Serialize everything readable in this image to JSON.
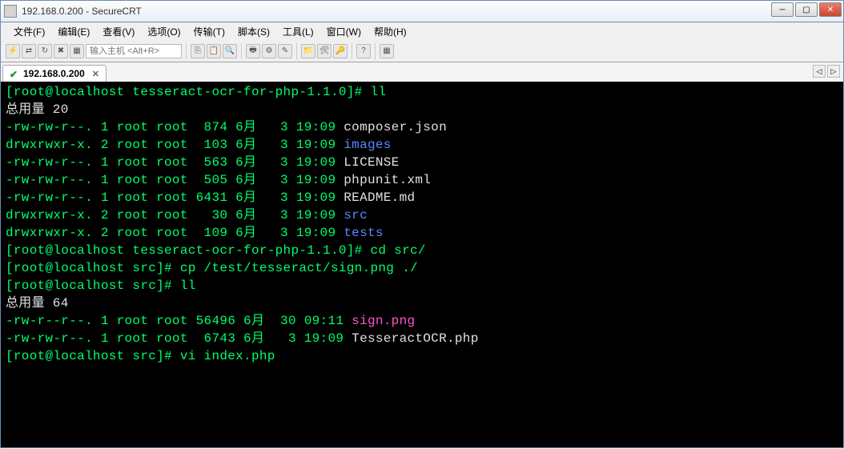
{
  "window": {
    "title": "192.168.0.200 - SecureCRT"
  },
  "menubar": [
    "文件(F)",
    "编辑(E)",
    "查看(V)",
    "选项(O)",
    "传输(T)",
    "脚本(S)",
    "工具(L)",
    "窗口(W)",
    "帮助(H)"
  ],
  "toolbar": {
    "host_placeholder": "输入主机 <Alt+R>"
  },
  "tab": {
    "label": "192.168.0.200"
  },
  "terminal": {
    "lines": [
      {
        "segments": [
          {
            "cls": "c-green",
            "text": "[root@localhost tesseract-ocr-for-php-1.1.0]# ll"
          }
        ]
      },
      {
        "segments": [
          {
            "cls": "c-white",
            "text": "总用量 20"
          }
        ]
      },
      {
        "segments": [
          {
            "cls": "c-green",
            "text": "-rw-rw-r--. 1 root root  874 6月   3 19:09 "
          },
          {
            "cls": "c-white",
            "text": "composer.json"
          }
        ]
      },
      {
        "segments": [
          {
            "cls": "c-green",
            "text": "drwxrwxr-x. 2 root root  103 6月   3 19:09 "
          },
          {
            "cls": "c-blue",
            "text": "images"
          }
        ]
      },
      {
        "segments": [
          {
            "cls": "c-green",
            "text": "-rw-rw-r--. 1 root root  563 6月   3 19:09 "
          },
          {
            "cls": "c-white",
            "text": "LICENSE"
          }
        ]
      },
      {
        "segments": [
          {
            "cls": "c-green",
            "text": "-rw-rw-r--. 1 root root  505 6月   3 19:09 "
          },
          {
            "cls": "c-white",
            "text": "phpunit.xml"
          }
        ]
      },
      {
        "segments": [
          {
            "cls": "c-green",
            "text": "-rw-rw-r--. 1 root root 6431 6月   3 19:09 "
          },
          {
            "cls": "c-white",
            "text": "README.md"
          }
        ]
      },
      {
        "segments": [
          {
            "cls": "c-green",
            "text": "drwxrwxr-x. 2 root root   30 6月   3 19:09 "
          },
          {
            "cls": "c-blue",
            "text": "src"
          }
        ]
      },
      {
        "segments": [
          {
            "cls": "c-green",
            "text": "drwxrwxr-x. 2 root root  109 6月   3 19:09 "
          },
          {
            "cls": "c-blue",
            "text": "tests"
          }
        ]
      },
      {
        "segments": [
          {
            "cls": "c-green",
            "text": "[root@localhost tesseract-ocr-for-php-1.1.0]# cd src/"
          }
        ]
      },
      {
        "segments": [
          {
            "cls": "c-green",
            "text": "[root@localhost src]# cp /test/tesseract/sign.png ./"
          }
        ]
      },
      {
        "segments": [
          {
            "cls": "c-green",
            "text": "[root@localhost src]# ll"
          }
        ]
      },
      {
        "segments": [
          {
            "cls": "c-white",
            "text": "总用量 64"
          }
        ]
      },
      {
        "segments": [
          {
            "cls": "c-green",
            "text": "-rw-r--r--. 1 root root 56496 6月  30 09:11 "
          },
          {
            "cls": "c-magenta",
            "text": "sign.png"
          }
        ]
      },
      {
        "segments": [
          {
            "cls": "c-green",
            "text": "-rw-rw-r--. 1 root root  6743 6月   3 19:09 "
          },
          {
            "cls": "c-white",
            "text": "TesseractOCR.php"
          }
        ]
      },
      {
        "segments": [
          {
            "cls": "c-green",
            "text": "[root@localhost src]# vi index.php"
          }
        ]
      }
    ]
  }
}
